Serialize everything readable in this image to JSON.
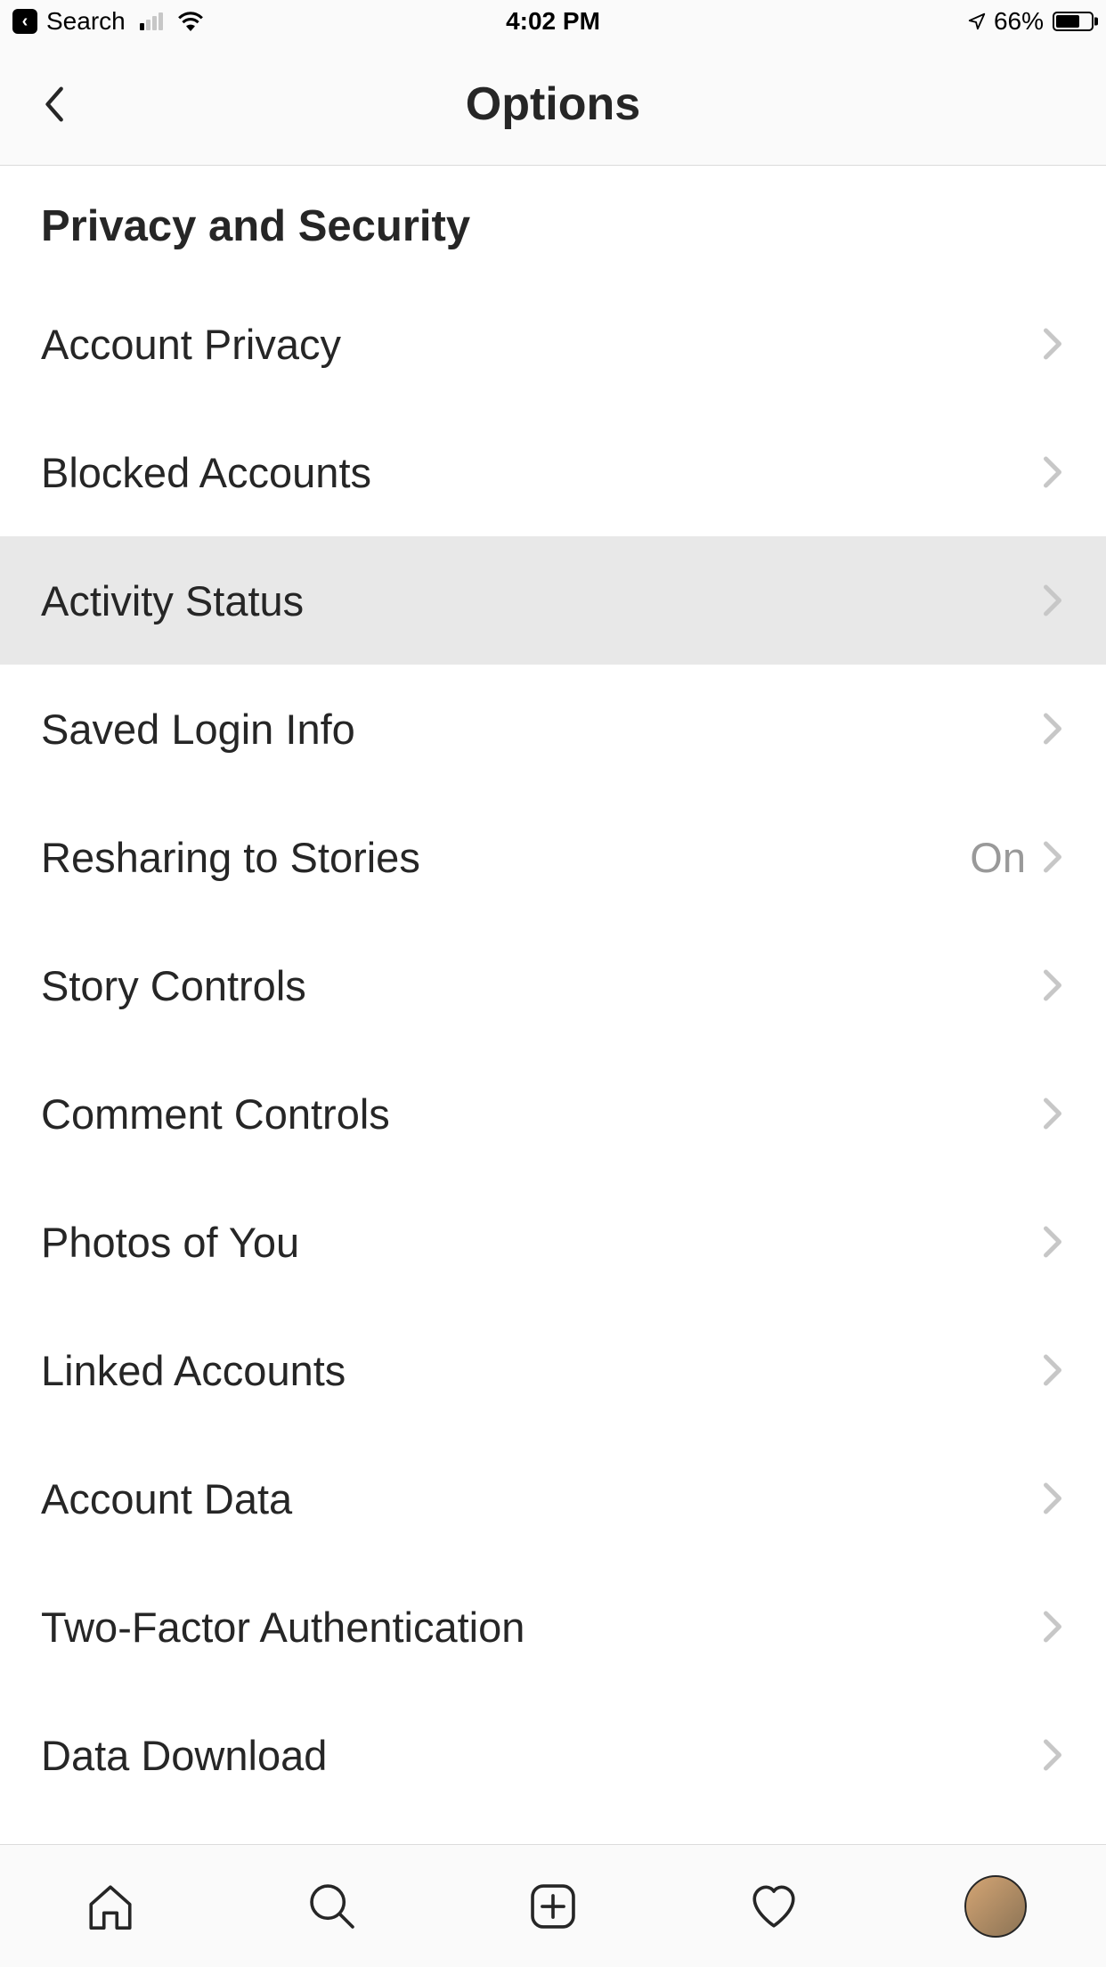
{
  "statusBar": {
    "backAppLabel": "Search",
    "time": "4:02 PM",
    "batteryPercent": "66%"
  },
  "navHeader": {
    "title": "Options"
  },
  "section": {
    "title": "Privacy and Security",
    "items": [
      {
        "label": "Account Privacy",
        "value": "",
        "highlighted": false
      },
      {
        "label": "Blocked Accounts",
        "value": "",
        "highlighted": false
      },
      {
        "label": "Activity Status",
        "value": "",
        "highlighted": true
      },
      {
        "label": "Saved Login Info",
        "value": "",
        "highlighted": false
      },
      {
        "label": "Resharing to Stories",
        "value": "On",
        "highlighted": false
      },
      {
        "label": "Story Controls",
        "value": "",
        "highlighted": false
      },
      {
        "label": "Comment Controls",
        "value": "",
        "highlighted": false
      },
      {
        "label": "Photos of You",
        "value": "",
        "highlighted": false
      },
      {
        "label": "Linked Accounts",
        "value": "",
        "highlighted": false
      },
      {
        "label": "Account Data",
        "value": "",
        "highlighted": false
      },
      {
        "label": "Two-Factor Authentication",
        "value": "",
        "highlighted": false
      },
      {
        "label": "Data Download",
        "value": "",
        "highlighted": false
      }
    ]
  }
}
